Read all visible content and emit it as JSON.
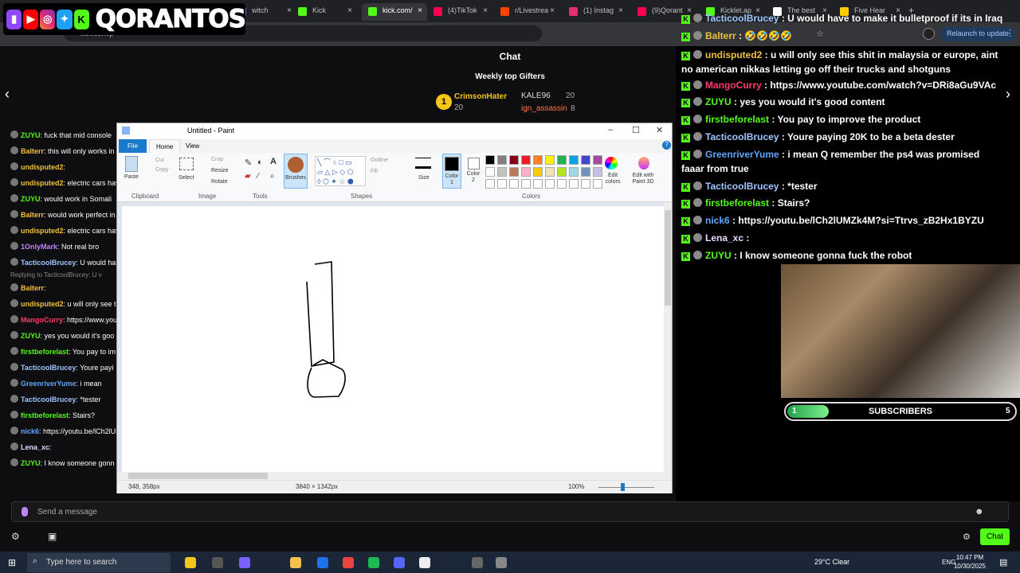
{
  "browser": {
    "tabs": [
      {
        "label": "witch",
        "color": "#9147ff"
      },
      {
        "label": "Kick",
        "color": "#53fc18"
      },
      {
        "label": "kick.com/",
        "color": "#53fc18"
      },
      {
        "label": "(4)TikTok",
        "color": "#ff0050"
      },
      {
        "label": "r/Livestrea",
        "color": "#ff4500"
      },
      {
        "label": "(1) Instag",
        "color": "#e1306c"
      },
      {
        "label": "(9)Qorant",
        "color": "#ff0050"
      },
      {
        "label": "Kicklet.ap",
        "color": "#53fc18"
      },
      {
        "label": "The best",
        "color": "#fff"
      },
      {
        "label": "Five Hear",
        "color": "#ffcc00"
      }
    ],
    "close_glyph": "×",
    "new_tab": "+",
    "url": "kick.com/p",
    "relaunch": "Relaunch to update"
  },
  "logo": {
    "name": "QORANTOS"
  },
  "nav": {
    "prev": "‹",
    "next": "›"
  },
  "chat_header": {
    "title": "Chat",
    "gifters_title": "Weekly top Gifters"
  },
  "gifters": [
    {
      "rank": "1",
      "name": "CrimsonHater",
      "count": "20"
    },
    {
      "name": "KALE96",
      "count": "20"
    },
    {
      "name": "ign_assassin",
      "count": "8"
    }
  ],
  "left_chat": [
    {
      "user": "ZUYU",
      "text": "fuck that mid console",
      "color": "#53fc18"
    },
    {
      "user": "Balterr",
      "text": "this will only works in de",
      "color": "#f0c040"
    },
    {
      "user": "undisputed2",
      "text": "",
      "color": "#f0c040"
    },
    {
      "user": "undisputed2",
      "text": "electric cars have",
      "color": "#f0c040"
    },
    {
      "user": "ZUYU",
      "text": "would work in Somali",
      "color": "#53fc18"
    },
    {
      "user": "Balterr",
      "text": "would work perfect in Ira",
      "color": "#f0c040"
    },
    {
      "user": "undisputed2",
      "text": "electric cars have",
      "color": "#f0c040"
    },
    {
      "user": "1OnlyMark",
      "text": "Not real bro",
      "color": "#c084fc"
    },
    {
      "user": "TacticoolBrucey",
      "text": "U would ha",
      "color": "#9fc5ff"
    },
    {
      "user": "Balterr",
      "text": "",
      "color": "#f0c040"
    },
    {
      "user": "undisputed2",
      "text": "u will only see this",
      "color": "#f0c040"
    },
    {
      "user": "MangoCurry",
      "text": "https://www.youtu",
      "color": "#ff3b6b"
    },
    {
      "user": "ZUYU",
      "text": "yes you would it's goo",
      "color": "#53fc18"
    },
    {
      "user": "firstbeforelast",
      "text": "You pay to im",
      "color": "#53fc18"
    },
    {
      "user": "TacticoolBrucey",
      "text": "Youre payi",
      "color": "#9fc5ff"
    },
    {
      "user": "GreenriverYume",
      "text": "i mean",
      "color": "#60a5fa"
    },
    {
      "user": "TacticoolBrucey",
      "text": "*tester",
      "color": "#9fc5ff"
    },
    {
      "user": "firstbeforelast",
      "text": "Stairs?",
      "color": "#53fc18"
    },
    {
      "user": "nick6",
      "text": "https://youtu.be/lCh2lUM",
      "color": "#60a5fa"
    },
    {
      "user": "Lena_xc",
      "text": "",
      "color": "#e9d5ff"
    },
    {
      "user": "ZUYU",
      "text": "I know someone gonn",
      "color": "#53fc18"
    }
  ],
  "reply_hint": "Replying to TacticoolBrucey: U v",
  "paint": {
    "title": "Untitled - Paint",
    "tabs": {
      "file": "File",
      "home": "Home",
      "view": "View"
    },
    "clipboard": {
      "paste": "Paste",
      "cut": "Cut",
      "copy": "Copy",
      "label": "Clipboard"
    },
    "image": {
      "select": "Select",
      "crop": "Crop",
      "resize": "Resize",
      "rotate": "Rotate",
      "label": "Image"
    },
    "tools_label": "Tools",
    "brushes": "Brushes",
    "shapes": {
      "outline": "Outline",
      "fill": "Fill",
      "label": "Shapes"
    },
    "size": "Size",
    "color1": "Color 1",
    "color2": "Color 2",
    "colors_label": "Colors",
    "edit_colors": "Edit colors",
    "edit_3d": "Edit with Paint 3D",
    "palette": [
      "#000000",
      "#7f7f7f",
      "#880015",
      "#ed1c24",
      "#ff7f27",
      "#fff200",
      "#22b14c",
      "#00a2e8",
      "#3f48cc",
      "#a349a4",
      "#ffffff",
      "#c3c3c3",
      "#b97a57",
      "#ffaec9",
      "#ffc90e",
      "#efe4b0",
      "#b5e61d",
      "#99d9ea",
      "#7092be",
      "#c8bfe7"
    ],
    "status": {
      "cursor": "348, 358px",
      "size": "3840 × 1342px",
      "zoom": "100%"
    }
  },
  "right_chat": [
    {
      "user": "TacticoolBrucey",
      "text": "U would have to make it bulletproof if its in Iraq",
      "color": "#9fc5ff"
    },
    {
      "user": "Balterr",
      "text": "🤣🤣🤣🤣",
      "color": "#f0c040"
    },
    {
      "user": "undisputed2",
      "text": "u will only see this shit in malaysia or europe, aint no american nikkas letting go off their trucks and shotguns",
      "color": "#f0c040"
    },
    {
      "user": "MangoCurry",
      "text": "https://www.youtube.com/watch?v=DRi8aGu9VAc",
      "color": "#ff3b6b"
    },
    {
      "user": "ZUYU",
      "text": "yes you would it's good content",
      "color": "#53fc18"
    },
    {
      "user": "firstbeforelast",
      "text": "You pay to improve the product",
      "color": "#53fc18"
    },
    {
      "user": "TacticoolBrucey",
      "text": "Youre paying 20K to be a beta dester",
      "color": "#9fc5ff"
    },
    {
      "user": "GreenriverYume",
      "text": "i mean Q remember the ps4 was promised",
      "color": "#60a5fa"
    },
    {
      "user": "",
      "text": "faaar from true",
      "color": "#fff"
    },
    {
      "user": "TacticoolBrucey",
      "text": "*tester",
      "color": "#9fc5ff"
    },
    {
      "user": "firstbeforelast",
      "text": "Stairs?",
      "color": "#53fc18"
    },
    {
      "user": "nick6",
      "text": "https://youtu.be/lCh2lUMZk4M?si=Ttrvs_zB2Hx1BYZU",
      "color": "#60a5fa"
    },
    {
      "user": "Lena_xc",
      "text": "",
      "color": "#e9d5ff"
    },
    {
      "user": "ZUYU",
      "text": "I know someone gonna fuck the robot",
      "color": "#53fc18"
    }
  ],
  "subscribers": {
    "current": "1",
    "label": "SUBSCRIBERS",
    "goal": "5",
    "progress": 0.2
  },
  "message": {
    "placeholder": "Send a message",
    "chat_button": "Chat"
  },
  "taskbar": {
    "search": "Type here to search",
    "weather": "29°C  Clear",
    "lang": "ENG",
    "time": "10:47 PM",
    "date": "10/30/2025"
  }
}
